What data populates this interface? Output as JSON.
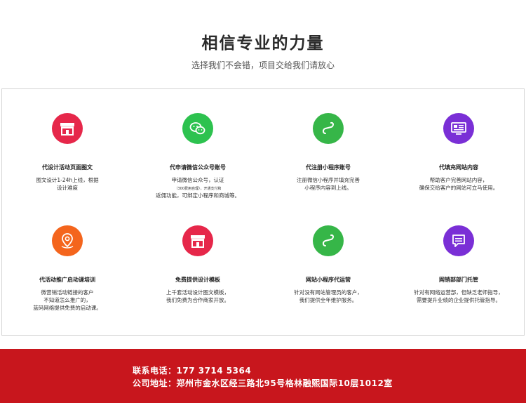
{
  "header": {
    "title": "相信专业的力量",
    "subtitle": "选择我们不会错，项目交给我们请放心"
  },
  "services": [
    {
      "title": "代设计活动页面图文",
      "lines": [
        "图文设计1-24h上线，根据",
        "设计难度"
      ],
      "icon": "storefront-icon",
      "color": "#e6274a"
    },
    {
      "title": "代申请微信公众号账号",
      "lines": [
        "申请微信公众号，认证",
        "（300费用自理），开通支付和",
        "返佣功能，可绑定小程序和商城等。"
      ],
      "icon": "wechat-icon",
      "color": "#2dc24f"
    },
    {
      "title": "代注册小程序账号",
      "lines": [
        "注册微信小程序并填充完善",
        "小程序内容到上线。"
      ],
      "icon": "mini-program-icon",
      "color": "#36b648"
    },
    {
      "title": "代填充网站内容",
      "lines": [
        "帮助客户完善网站内容，",
        "确保交给客户的网站可立马使用。"
      ],
      "icon": "monitor-icon",
      "color": "#7a2fd6"
    },
    {
      "title": "代活动推广启动课培训",
      "lines": [
        "微营销活动链接的客户",
        "不知道怎么推广的，",
        "蓝码网络提供免费的启动课。"
      ],
      "icon": "location-pin-icon",
      "color": "#f4651d"
    },
    {
      "title": "免费提供设计模板",
      "lines": [
        "上千套活动设计图文模板，",
        "我们免费为合作商家开放。"
      ],
      "icon": "storefront-icon",
      "color": "#e6274a"
    },
    {
      "title": "网站小程序代运营",
      "lines": [
        "针对没有网站管理员的客户，",
        "我们提供全年维护服务。"
      ],
      "icon": "mini-program-icon",
      "color": "#36b648"
    },
    {
      "title": "网销部部门托管",
      "lines": [
        "针对有网络运营部，但缺乏老师指导，",
        "需要提升业绩的企业提供托管指导。"
      ],
      "icon": "message-icon",
      "color": "#7a2fd6"
    }
  ],
  "footer": {
    "phone": "联系电话：177 3714 5364",
    "address": "公司地址：郑州市金水区经三路北95号格林融熙国际10层1012室"
  }
}
